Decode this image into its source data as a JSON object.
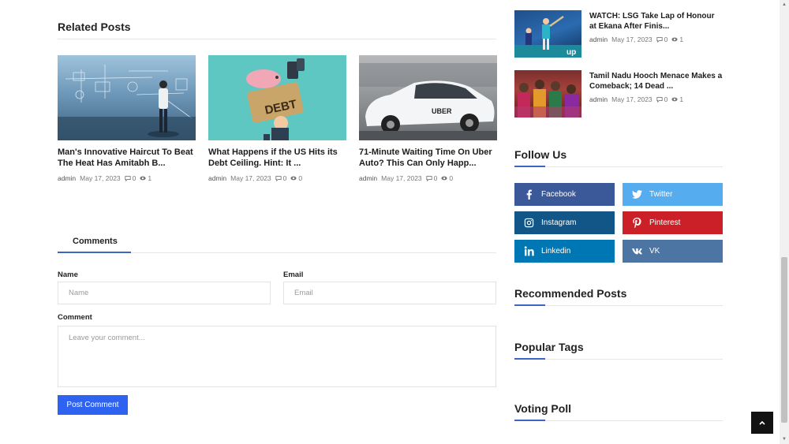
{
  "related": {
    "heading": "Related Posts",
    "posts": [
      {
        "title": "Man's Innovative Haircut To Beat The Heat Has Amitabh B...",
        "author": "admin",
        "date": "May 17, 2023",
        "comments": "0",
        "views": "1"
      },
      {
        "title": "What Happens if the US Hits its Debt Ceiling. Hint: It ...",
        "author": "admin",
        "date": "May 17, 2023",
        "comments": "0",
        "views": "0",
        "thumb_text": "DEBT"
      },
      {
        "title": "71-Minute Waiting Time On Uber Auto? This Can Only Happ...",
        "author": "admin",
        "date": "May 17, 2023",
        "comments": "0",
        "views": "0",
        "thumb_text": "UBER"
      }
    ]
  },
  "comments": {
    "tab": "Comments",
    "name_label": "Name",
    "name_placeholder": "Name",
    "email_label": "Email",
    "email_placeholder": "Email",
    "comment_label": "Comment",
    "comment_placeholder": "Leave your comment...",
    "submit": "Post Comment"
  },
  "sidebar": {
    "posts": [
      {
        "title": "WATCH: LSG Take Lap of Honour at Ekana After Finis...",
        "author": "admin",
        "date": "May 17, 2023",
        "comments": "0",
        "views": "1",
        "thumb_text": "up"
      },
      {
        "title": "Tamil Nadu Hooch Menace Makes a Comeback; 14 Dead ...",
        "author": "admin",
        "date": "May 17, 2023",
        "comments": "0",
        "views": "1"
      }
    ],
    "follow_heading": "Follow Us",
    "social": [
      {
        "label": "Facebook",
        "icon": "facebook-icon",
        "color": "#3b5998"
      },
      {
        "label": "Twitter",
        "icon": "twitter-icon",
        "color": "#55acee"
      },
      {
        "label": "Instagram",
        "icon": "instagram-icon",
        "color": "#125688"
      },
      {
        "label": "Pinterest",
        "icon": "pinterest-icon",
        "color": "#cb2027"
      },
      {
        "label": "Linkedin",
        "icon": "linkedin-icon",
        "color": "#0077b5"
      },
      {
        "label": "VK",
        "icon": "vk-icon",
        "color": "#4c75a3"
      }
    ],
    "recommended_heading": "Recommended Posts",
    "tags_heading": "Popular Tags",
    "poll_heading": "Voting Poll"
  },
  "colors": {
    "accent": "#3f65c4",
    "button": "#2d63f0"
  },
  "icons": {
    "back_to_top": "chevron-up-icon",
    "comments": "comment-icon",
    "views": "eye-icon"
  }
}
